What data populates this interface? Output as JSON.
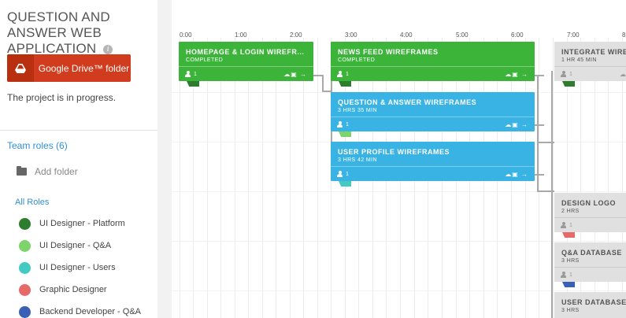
{
  "project": {
    "title": "QUESTION AND ANSWER WEB APPLICATION",
    "info_glyph": "i",
    "gdrive_label": "Google Drive™ folder",
    "status": "The project is in progress."
  },
  "sidebar": {
    "team_roles": "Team roles (6)",
    "add_folder": "Add folder",
    "all_roles": "All Roles",
    "roles": [
      {
        "name": "UI Designer - Platform",
        "color": "#2e7d2e"
      },
      {
        "name": "UI Designer - Q&A",
        "color": "#7ed36a"
      },
      {
        "name": "UI Designer - Users",
        "color": "#45c9c3"
      },
      {
        "name": "Graphic Designer",
        "color": "#e56a68"
      },
      {
        "name": "Backend Developer - Q&A",
        "color": "#3a5fb5"
      }
    ]
  },
  "timeline": {
    "hours": [
      "0:00",
      "1:00",
      "2:00",
      "3:00",
      "4:00",
      "5:00",
      "6:00",
      "7:00",
      "8"
    ],
    "tasks": [
      {
        "title": "HOMEPAGE & LOGIN WIREFR...",
        "subtitle": "COMPLETED",
        "people": "1",
        "actions": "☁▣ →",
        "color": "green",
        "tab_color": "#2e7d2e"
      },
      {
        "title": "NEWS FEED WIREFRAMES",
        "subtitle": "COMPLETED",
        "people": "1",
        "actions": "☁▣ →",
        "color": "green",
        "tab_color": "#2e7d2e"
      },
      {
        "title": "QUESTION & ANSWER WIREFRAMES",
        "subtitle": "3 HRS 35 MIN",
        "people": "1",
        "actions": "☁▣ →",
        "color": "blue",
        "tab_color": "#7ed36a"
      },
      {
        "title": "USER PROFILE WIREFRAMES",
        "subtitle": "3 HRS 42 MIN",
        "people": "1",
        "actions": "☁▣ →",
        "color": "blue",
        "tab_color": "#45c9c3"
      },
      {
        "title": "INTEGRATE WIRE",
        "subtitle": "1 HR 45 MIN",
        "people": "1",
        "actions": "☁",
        "color": "grey",
        "tab_color": "#2e7d2e"
      },
      {
        "title": "DESIGN LOGO",
        "subtitle": "2 HRS",
        "people": "1",
        "actions": "",
        "color": "grey",
        "tab_color": "#e56a68"
      },
      {
        "title": "Q&A DATABASE",
        "subtitle": "3 HRS",
        "people": "1",
        "actions": "",
        "color": "grey",
        "tab_color": "#3a5fb5"
      },
      {
        "title": "USER DATABASE",
        "subtitle": "3 HRS",
        "people": "",
        "actions": "",
        "color": "grey",
        "tab_color": ""
      }
    ]
  }
}
